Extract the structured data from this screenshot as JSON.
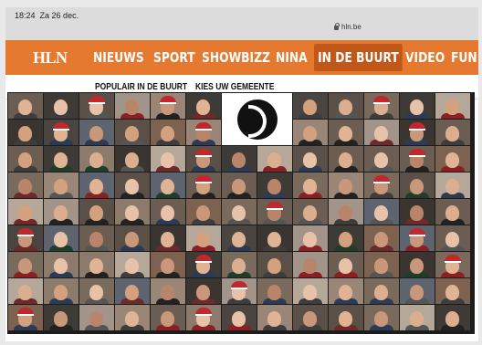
{
  "status": {
    "time": "18:24",
    "date": "Za 26 dec.",
    "url": "hln.be"
  },
  "nav": {
    "logo": "HLN",
    "items": [
      "NIEUWS",
      "SPORT",
      "SHOWBIZZ",
      "NINA",
      "IN DE BUURT",
      "VIDEO",
      "FUN"
    ],
    "active": "IN DE BUURT"
  },
  "subnav": {
    "items": [
      "POPULAIR IN DE BUURT",
      "KIES UW GEMEENTE"
    ]
  },
  "colors": {
    "brand": "#e4792f",
    "active": "#c0581a"
  }
}
